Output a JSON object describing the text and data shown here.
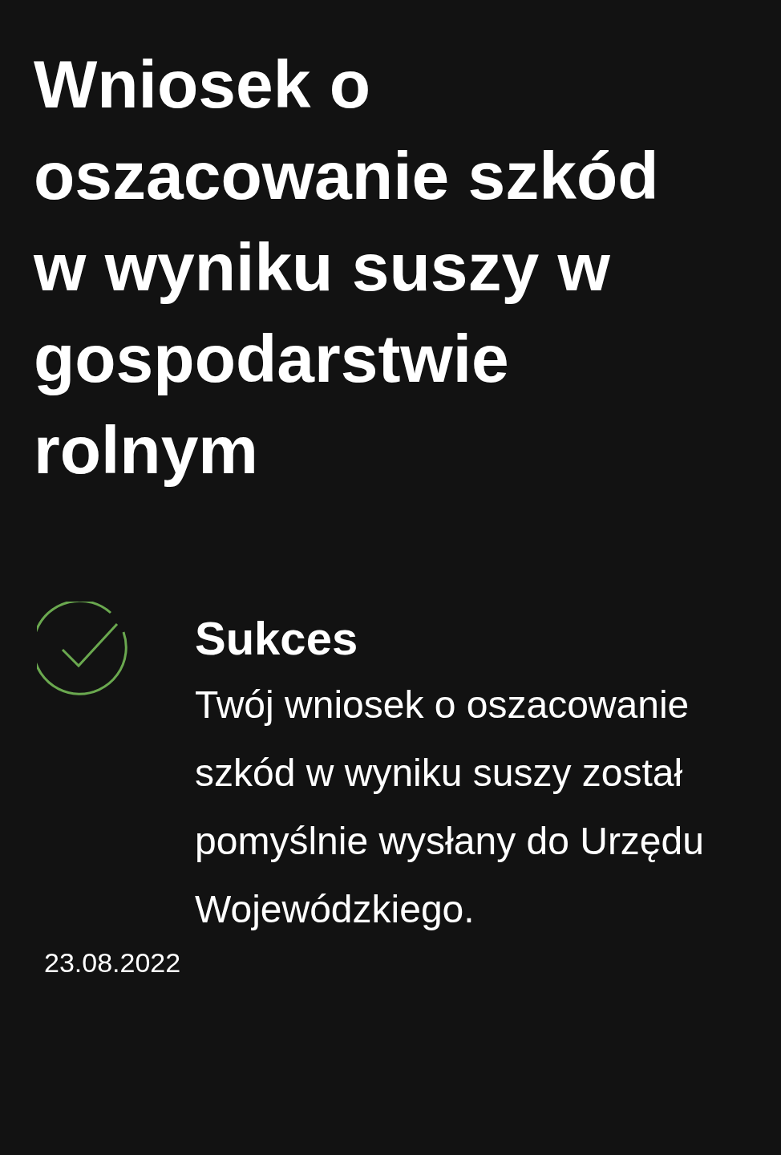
{
  "title": "Wniosek o oszacowanie szkód w wyniku suszy w gospodarstwie rolnym",
  "status": {
    "kind": "success",
    "heading": "Sukces",
    "message": "Twój wniosek o oszacowanie szkód w wyniku suszy został pomyślnie wysłany do Urzędu Wojewódzkiego."
  },
  "date": "23.08.2022"
}
